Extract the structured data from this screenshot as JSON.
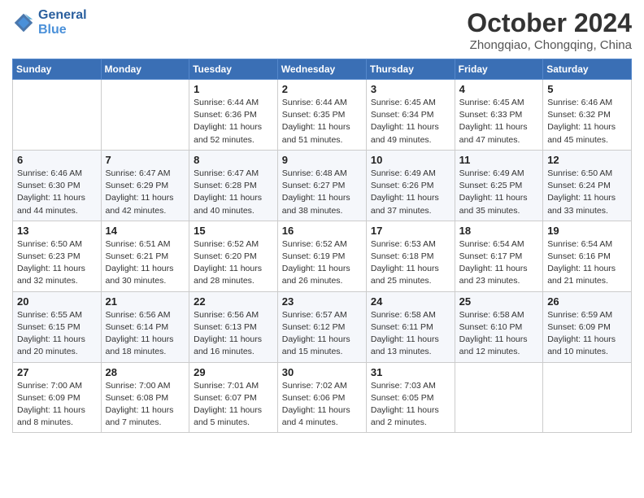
{
  "header": {
    "logo_line1": "General",
    "logo_line2": "Blue",
    "month_title": "October 2024",
    "location": "Zhongqiao, Chongqing, China"
  },
  "weekdays": [
    "Sunday",
    "Monday",
    "Tuesday",
    "Wednesday",
    "Thursday",
    "Friday",
    "Saturday"
  ],
  "weeks": [
    [
      {
        "day": "",
        "info": ""
      },
      {
        "day": "",
        "info": ""
      },
      {
        "day": "1",
        "info": "Sunrise: 6:44 AM\nSunset: 6:36 PM\nDaylight: 11 hours and 52 minutes."
      },
      {
        "day": "2",
        "info": "Sunrise: 6:44 AM\nSunset: 6:35 PM\nDaylight: 11 hours and 51 minutes."
      },
      {
        "day": "3",
        "info": "Sunrise: 6:45 AM\nSunset: 6:34 PM\nDaylight: 11 hours and 49 minutes."
      },
      {
        "day": "4",
        "info": "Sunrise: 6:45 AM\nSunset: 6:33 PM\nDaylight: 11 hours and 47 minutes."
      },
      {
        "day": "5",
        "info": "Sunrise: 6:46 AM\nSunset: 6:32 PM\nDaylight: 11 hours and 45 minutes."
      }
    ],
    [
      {
        "day": "6",
        "info": "Sunrise: 6:46 AM\nSunset: 6:30 PM\nDaylight: 11 hours and 44 minutes."
      },
      {
        "day": "7",
        "info": "Sunrise: 6:47 AM\nSunset: 6:29 PM\nDaylight: 11 hours and 42 minutes."
      },
      {
        "day": "8",
        "info": "Sunrise: 6:47 AM\nSunset: 6:28 PM\nDaylight: 11 hours and 40 minutes."
      },
      {
        "day": "9",
        "info": "Sunrise: 6:48 AM\nSunset: 6:27 PM\nDaylight: 11 hours and 38 minutes."
      },
      {
        "day": "10",
        "info": "Sunrise: 6:49 AM\nSunset: 6:26 PM\nDaylight: 11 hours and 37 minutes."
      },
      {
        "day": "11",
        "info": "Sunrise: 6:49 AM\nSunset: 6:25 PM\nDaylight: 11 hours and 35 minutes."
      },
      {
        "day": "12",
        "info": "Sunrise: 6:50 AM\nSunset: 6:24 PM\nDaylight: 11 hours and 33 minutes."
      }
    ],
    [
      {
        "day": "13",
        "info": "Sunrise: 6:50 AM\nSunset: 6:23 PM\nDaylight: 11 hours and 32 minutes."
      },
      {
        "day": "14",
        "info": "Sunrise: 6:51 AM\nSunset: 6:21 PM\nDaylight: 11 hours and 30 minutes."
      },
      {
        "day": "15",
        "info": "Sunrise: 6:52 AM\nSunset: 6:20 PM\nDaylight: 11 hours and 28 minutes."
      },
      {
        "day": "16",
        "info": "Sunrise: 6:52 AM\nSunset: 6:19 PM\nDaylight: 11 hours and 26 minutes."
      },
      {
        "day": "17",
        "info": "Sunrise: 6:53 AM\nSunset: 6:18 PM\nDaylight: 11 hours and 25 minutes."
      },
      {
        "day": "18",
        "info": "Sunrise: 6:54 AM\nSunset: 6:17 PM\nDaylight: 11 hours and 23 minutes."
      },
      {
        "day": "19",
        "info": "Sunrise: 6:54 AM\nSunset: 6:16 PM\nDaylight: 11 hours and 21 minutes."
      }
    ],
    [
      {
        "day": "20",
        "info": "Sunrise: 6:55 AM\nSunset: 6:15 PM\nDaylight: 11 hours and 20 minutes."
      },
      {
        "day": "21",
        "info": "Sunrise: 6:56 AM\nSunset: 6:14 PM\nDaylight: 11 hours and 18 minutes."
      },
      {
        "day": "22",
        "info": "Sunrise: 6:56 AM\nSunset: 6:13 PM\nDaylight: 11 hours and 16 minutes."
      },
      {
        "day": "23",
        "info": "Sunrise: 6:57 AM\nSunset: 6:12 PM\nDaylight: 11 hours and 15 minutes."
      },
      {
        "day": "24",
        "info": "Sunrise: 6:58 AM\nSunset: 6:11 PM\nDaylight: 11 hours and 13 minutes."
      },
      {
        "day": "25",
        "info": "Sunrise: 6:58 AM\nSunset: 6:10 PM\nDaylight: 11 hours and 12 minutes."
      },
      {
        "day": "26",
        "info": "Sunrise: 6:59 AM\nSunset: 6:09 PM\nDaylight: 11 hours and 10 minutes."
      }
    ],
    [
      {
        "day": "27",
        "info": "Sunrise: 7:00 AM\nSunset: 6:09 PM\nDaylight: 11 hours and 8 minutes."
      },
      {
        "day": "28",
        "info": "Sunrise: 7:00 AM\nSunset: 6:08 PM\nDaylight: 11 hours and 7 minutes."
      },
      {
        "day": "29",
        "info": "Sunrise: 7:01 AM\nSunset: 6:07 PM\nDaylight: 11 hours and 5 minutes."
      },
      {
        "day": "30",
        "info": "Sunrise: 7:02 AM\nSunset: 6:06 PM\nDaylight: 11 hours and 4 minutes."
      },
      {
        "day": "31",
        "info": "Sunrise: 7:03 AM\nSunset: 6:05 PM\nDaylight: 11 hours and 2 minutes."
      },
      {
        "day": "",
        "info": ""
      },
      {
        "day": "",
        "info": ""
      }
    ]
  ]
}
